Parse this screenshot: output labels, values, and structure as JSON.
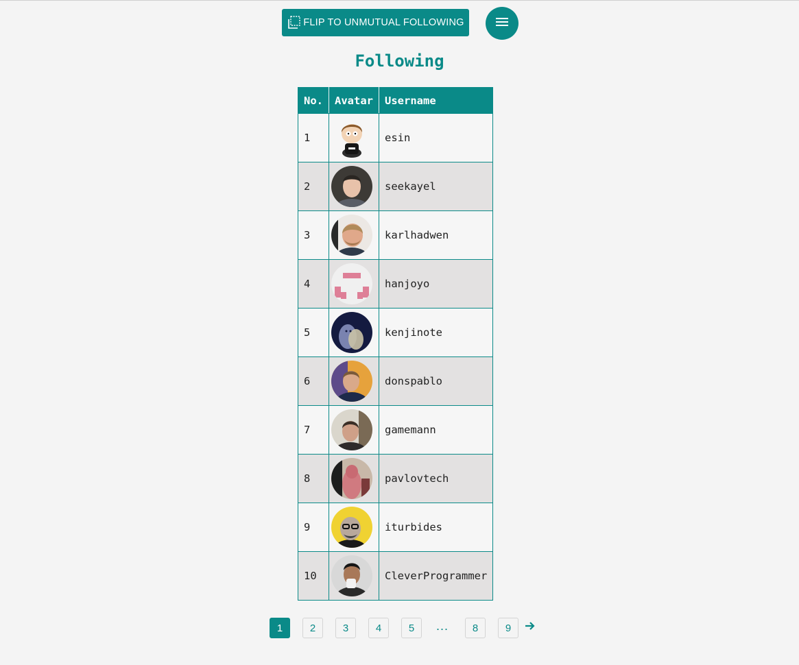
{
  "toolbar": {
    "flip_label": "FLIP TO UNMUTUAL FOLLOWING",
    "flip_icon": "flip-icon",
    "menu_icon": "hamburger-menu-icon"
  },
  "page": {
    "title": "Following"
  },
  "table": {
    "headers": [
      "No.",
      "Avatar",
      "Username"
    ],
    "rows": [
      {
        "no": "1",
        "username": "esin",
        "avatar": "cartoon-character-avatar"
      },
      {
        "no": "2",
        "username": "seekayel",
        "avatar": "photo-avatar"
      },
      {
        "no": "3",
        "username": "karlhadwen",
        "avatar": "photo-avatar"
      },
      {
        "no": "4",
        "username": "hanjoyo",
        "avatar": "identicon-avatar"
      },
      {
        "no": "5",
        "username": "kenjinote",
        "avatar": "illustration-avatar"
      },
      {
        "no": "6",
        "username": "donspablo",
        "avatar": "photo-avatar"
      },
      {
        "no": "7",
        "username": "gamemann",
        "avatar": "photo-avatar"
      },
      {
        "no": "8",
        "username": "pavlovtech",
        "avatar": "photo-avatar"
      },
      {
        "no": "9",
        "username": "iturbides",
        "avatar": "photo-avatar"
      },
      {
        "no": "10",
        "username": "CleverProgrammer",
        "avatar": "photo-avatar"
      }
    ]
  },
  "pagination": {
    "pages": [
      "1",
      "2",
      "3",
      "4",
      "5"
    ],
    "ellipsis": "...",
    "last_pages": [
      "8",
      "9"
    ],
    "current": "1",
    "next_icon": "arrow-right-icon"
  },
  "colors": {
    "accent": "#0a8a88",
    "background": "#f4f4f4",
    "row_alt": "#e3e1e1"
  }
}
